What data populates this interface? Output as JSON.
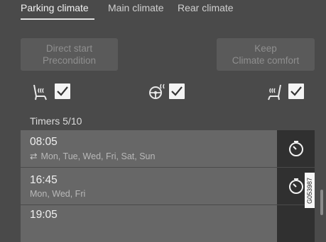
{
  "tabs": [
    {
      "label": "Parking climate",
      "active": true
    },
    {
      "label": "Main climate",
      "active": false
    },
    {
      "label": "Rear climate",
      "active": false
    }
  ],
  "buttons": {
    "direct_start": {
      "line1": "Direct start",
      "line2": "Precondition"
    },
    "keep_comfort": {
      "line1": "Keep",
      "line2": "Climate comfort"
    }
  },
  "seat_options": [
    {
      "icon": "seat-heating-icon",
      "checked": true
    },
    {
      "icon": "steering-wheel-heating-icon",
      "checked": true
    },
    {
      "icon": "rear-seat-heating-icon",
      "checked": true
    }
  ],
  "timers": {
    "title": "Timers 5/10",
    "items": [
      {
        "time": "08:05",
        "repeat_icon": "repeat-icon",
        "days": "Mon, Tue, Wed, Fri, Sat, Sun"
      },
      {
        "time": "16:45",
        "days": "Mon, Wed, Fri"
      },
      {
        "time": "19:05",
        "days": ""
      }
    ]
  },
  "image_code": "G053987",
  "colors": {
    "background": "#4a4a4a",
    "row": "#676767",
    "timer_button": "#303030",
    "checkbox": "#f4f4f4"
  }
}
